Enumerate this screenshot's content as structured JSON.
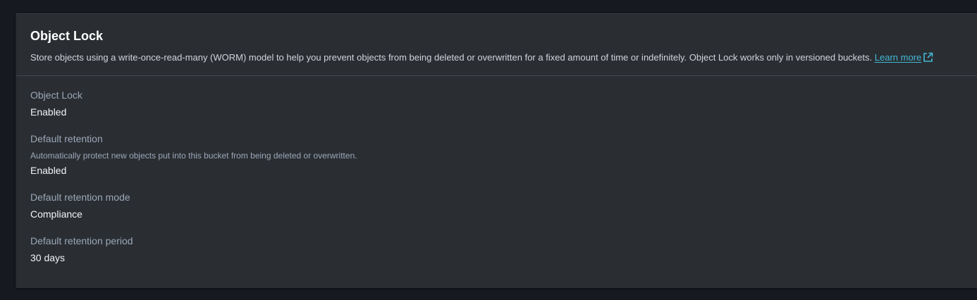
{
  "section": {
    "title": "Object Lock",
    "description": "Store objects using a write-once-read-many (WORM) model to help you prevent objects from being deleted or overwritten for a fixed amount of time or indefinitely. Object Lock works only in versioned buckets.",
    "learn_more_label": "Learn more",
    "learn_more_icon": "external-link-icon",
    "link_color": "#44b9d6"
  },
  "fields": {
    "object_lock": {
      "label": "Object Lock",
      "value": "Enabled"
    },
    "default_retention": {
      "label": "Default retention",
      "hint": "Automatically protect new objects put into this bucket from being deleted or overwritten.",
      "value": "Enabled"
    },
    "retention_mode": {
      "label": "Default retention mode",
      "value": "Compliance"
    },
    "retention_period": {
      "label": "Default retention period",
      "value": "30 days"
    }
  }
}
